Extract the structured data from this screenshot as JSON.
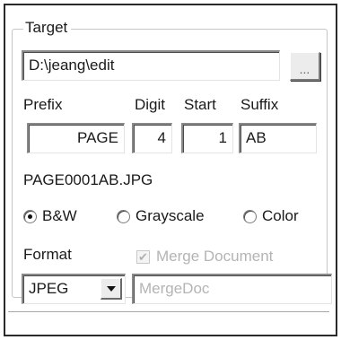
{
  "target": {
    "group_title": "Target",
    "path_value": "D:\\jeang\\edit",
    "browse_label": "..."
  },
  "naming": {
    "prefix_label": "Prefix",
    "digit_label": "Digit",
    "start_label": "Start",
    "suffix_label": "Suffix",
    "prefix_value": "PAGE",
    "digit_value": "4",
    "start_value": "1",
    "suffix_value": "AB",
    "preview": "PAGE0001AB.JPG"
  },
  "color_mode": {
    "options": [
      "B&W",
      "Grayscale",
      "Color"
    ],
    "selected": "B&W"
  },
  "output": {
    "format_label": "Format",
    "format_value": "JPEG",
    "merge_label": "Merge Document",
    "merge_checked": true,
    "merge_enabled": false,
    "merge_name": "MergeDoc"
  }
}
